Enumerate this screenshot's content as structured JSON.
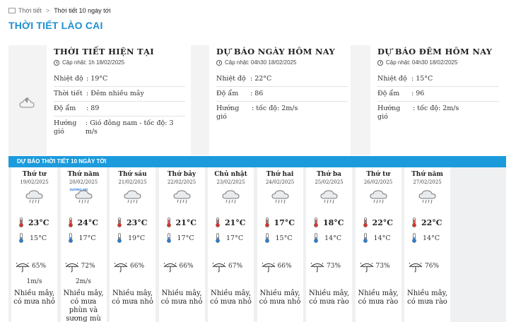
{
  "breadcrumb": {
    "root": "Thời tiết",
    "separator": ">",
    "current": "Thời tiết 10 ngày tới"
  },
  "page_title": "THỜI TIẾT LÀO CAI",
  "current": {
    "heading": "THỜI TIẾT HIỆN TẠI",
    "updated": "Cập nhật: 1h 18/02/2025",
    "rows": [
      {
        "label": "Nhiệt độ",
        "value": ": 19°C"
      },
      {
        "label": "Thời tiết",
        "value": ": Đêm nhiều mây"
      },
      {
        "label": "Độ ẩm",
        "value": ": 89"
      },
      {
        "label": "Hướng gió",
        "value": ": Gió đông nam - tốc độ: 3 m/s"
      }
    ],
    "icon": "night-cloud-icon"
  },
  "today": {
    "heading": "DỰ BÁO NGÀY HÔM NAY",
    "updated": "Cập nhật: 04h30 18/02/2025",
    "rows": [
      {
        "label": "Nhiệt độ",
        "value": ": 22°C"
      },
      {
        "label": "Độ ẩm",
        "value": ": 86"
      },
      {
        "label": "Hướng gió",
        "value": ": tốc độ: 2m/s"
      }
    ]
  },
  "tonight": {
    "heading": "DỰ BÁO ĐÊM HÔM NAY",
    "updated": "Cập nhật: 04h30 18/02/2025",
    "rows": [
      {
        "label": "Nhiệt độ",
        "value": ": 15°C"
      },
      {
        "label": "Độ ẩm",
        "value": ": 96"
      },
      {
        "label": "Hướng gió",
        "value": ": tốc độ: 2m/s"
      }
    ]
  },
  "forecast": {
    "heading": "DỰ BÁO THỜI TIẾT 10 NGÀY TỚI",
    "colors": {
      "bar": "#1b9bdc",
      "hot": "#d9342b",
      "cold": "#2a7fd4"
    },
    "days": [
      {
        "name": "Thứ tư",
        "date": "19/02/2025",
        "hi": "23°C",
        "lo": "15°C",
        "rain": "65%",
        "wind": "1m/s",
        "desc": "Nhiều mây, có mưa nhỏ",
        "icon": "rain-cloud-icon"
      },
      {
        "name": "Thứ năm",
        "date": "20/02/2025",
        "hi": "24°C",
        "lo": "17°C",
        "rain": "72%",
        "wind": "2m/s",
        "desc": "Nhiều mây, có mưa phùn và sương mù",
        "icon": "drizzle-fog-icon",
        "badge": "SƯƠNG MÙ"
      },
      {
        "name": "Thứ sáu",
        "date": "21/02/2025",
        "hi": "23°C",
        "lo": "19°C",
        "rain": "66%",
        "wind": "",
        "desc": "Nhiều mây, có mưa nhỏ",
        "icon": "rain-cloud-icon"
      },
      {
        "name": "Thứ bảy",
        "date": "22/02/2025",
        "hi": "21°C",
        "lo": "17°C",
        "rain": "66%",
        "wind": "",
        "desc": "Nhiều mây, có mưa nhỏ",
        "icon": "rain-cloud-icon"
      },
      {
        "name": "Chủ nhật",
        "date": "23/02/2025",
        "hi": "21°C",
        "lo": "17°C",
        "rain": "67%",
        "wind": "",
        "desc": "Nhiều mây, có mưa nhỏ",
        "icon": "rain-cloud-icon"
      },
      {
        "name": "Thứ hai",
        "date": "24/02/2025",
        "hi": "17°C",
        "lo": "15°C",
        "rain": "66%",
        "wind": "",
        "desc": "Nhiều mây, có mưa nhỏ",
        "icon": "rain-cloud-icon"
      },
      {
        "name": "Thứ ba",
        "date": "25/02/2025",
        "hi": "18°C",
        "lo": "14°C",
        "rain": "73%",
        "wind": "",
        "desc": "Nhiều mây, có mưa rào",
        "icon": "rain-cloud-icon"
      },
      {
        "name": "Thứ tư",
        "date": "26/02/2025",
        "hi": "22°C",
        "lo": "14°C",
        "rain": "73%",
        "wind": "",
        "desc": "Nhiều mây, có mưa rào",
        "icon": "rain-cloud-icon"
      },
      {
        "name": "Thứ năm",
        "date": "27/02/2025",
        "hi": "22°C",
        "lo": "14°C",
        "rain": "76%",
        "wind": "",
        "desc": "Nhiều mây, có mưa rào",
        "icon": "rain-cloud-icon"
      }
    ]
  }
}
